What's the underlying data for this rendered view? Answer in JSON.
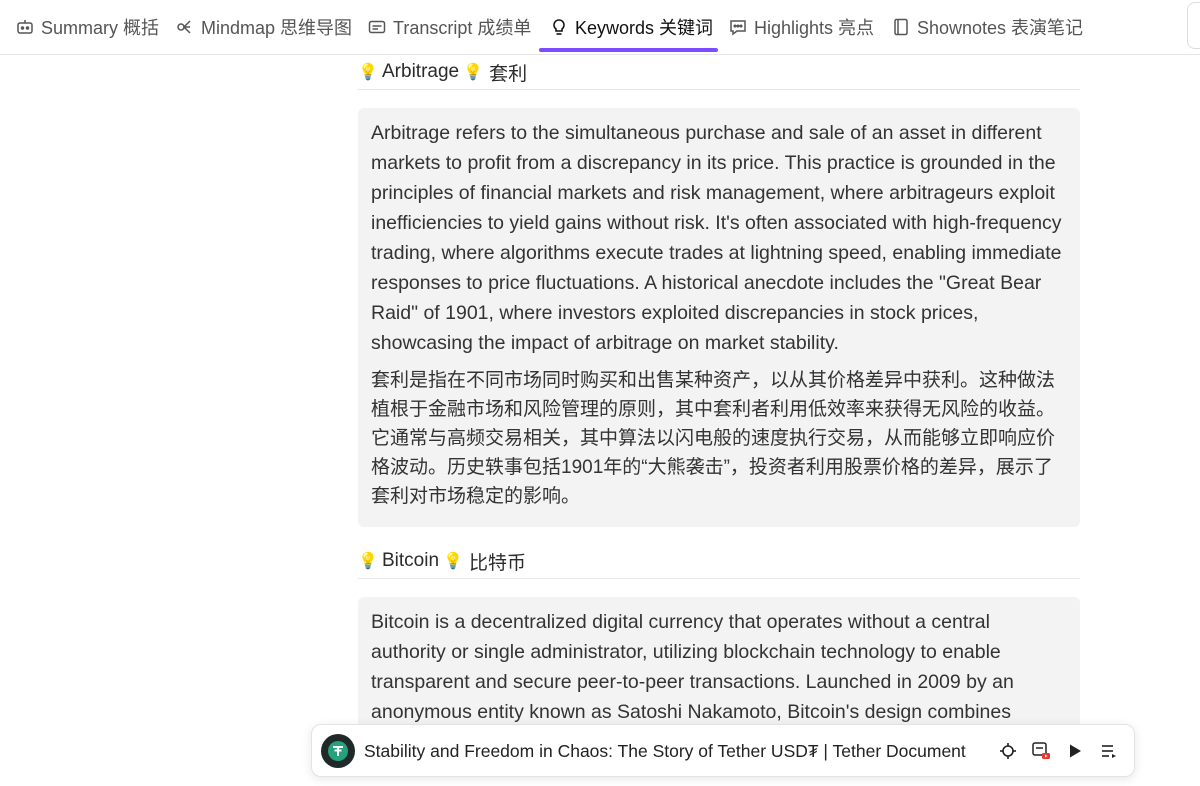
{
  "tabs": [
    {
      "label": "Summary 概括",
      "icon": "robot-icon"
    },
    {
      "label": "Mindmap 思维导图",
      "icon": "mindmap-icon"
    },
    {
      "label": "Transcript 成绩单",
      "icon": "transcript-icon"
    },
    {
      "label": "Keywords 关键词",
      "icon": "lightbulb-icon",
      "active": true
    },
    {
      "label": "Highlights 亮点",
      "icon": "chat-icon"
    },
    {
      "label": "Shownotes 表演笔记",
      "icon": "notes-icon"
    }
  ],
  "accent_color": "#7c4dff",
  "keywords": [
    {
      "term_en": "Arbitrage",
      "term_zh": "套利",
      "desc_en": "Arbitrage refers to the simultaneous purchase and sale of an asset in different markets to profit from a discrepancy in its price. This practice is grounded in the principles of financial markets and risk management, where arbitrageurs exploit inefficiencies to yield gains without risk. It's often associated with high-frequency trading, where algorithms execute trades at lightning speed, enabling immediate responses to price fluctuations. A historical anecdote includes the \"Great Bear Raid\" of 1901, where investors exploited discrepancies in stock prices, showcasing the impact of arbitrage on market stability.",
      "desc_zh": "套利是指在不同市场同时购买和出售某种资产，以从其价格差异中获利。这种做法植根于金融市场和风险管理的原则，其中套利者利用低效率来获得无风险的收益。它通常与高频交易相关，其中算法以闪电般的速度执行交易，从而能够立即响应价格波动。历史轶事包括1901年的“大熊袭击”，投资者利用股票价格的差异，展示了套利对市场稳定的影响。"
    },
    {
      "term_en": "Bitcoin",
      "term_zh": "比特币",
      "desc_en": "Bitcoin is a decentralized digital currency that operates without a central authority or single administrator, utilizing blockchain technology to enable transparent and secure peer-to-peer transactions. Launched in 2009 by an anonymous entity known as Satoshi Nakamoto, Bitcoin's design combines concepts from cryptography, game theory, and computer science. Its fixed"
    }
  ],
  "player": {
    "title": "Stability and Freedom in Chaos: The Story of Tether USD₮ | Tether Document"
  }
}
